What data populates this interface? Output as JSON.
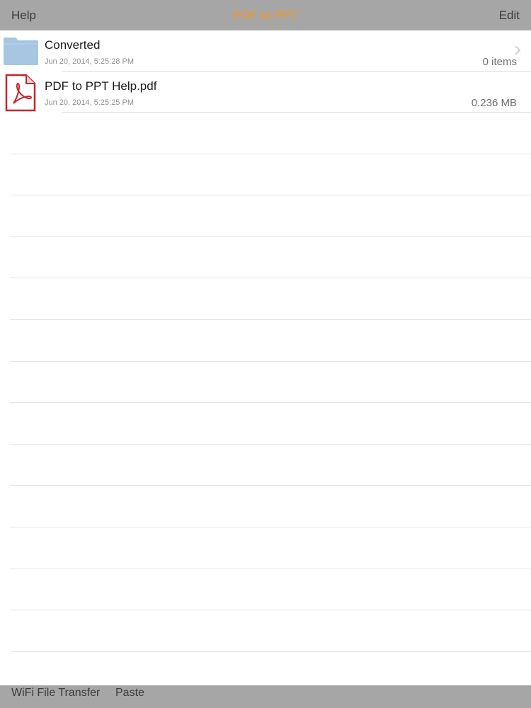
{
  "navbar": {
    "left_label": "Help",
    "title": "PDF to PPT",
    "title_color": "#f7941d",
    "right_label": "Edit"
  },
  "files": [
    {
      "name": "Converted",
      "date": "Jun 20, 2014, 5:25:28 PM",
      "meta": "0 items",
      "icon": "folder-icon",
      "has_chevron": true
    },
    {
      "name": "PDF to PPT Help.pdf",
      "date": "Jun 20, 2014, 5:25:25 PM",
      "meta": "0.236 MB",
      "icon": "pdf-icon",
      "has_chevron": false
    }
  ],
  "toolbar": {
    "wifi_label": "WiFi File Transfer",
    "paste_label": "Paste"
  },
  "colors": {
    "bar_background": "#a6a6a6",
    "folder_blue": "#a7c6e2",
    "pdf_red": "#c4262e"
  }
}
